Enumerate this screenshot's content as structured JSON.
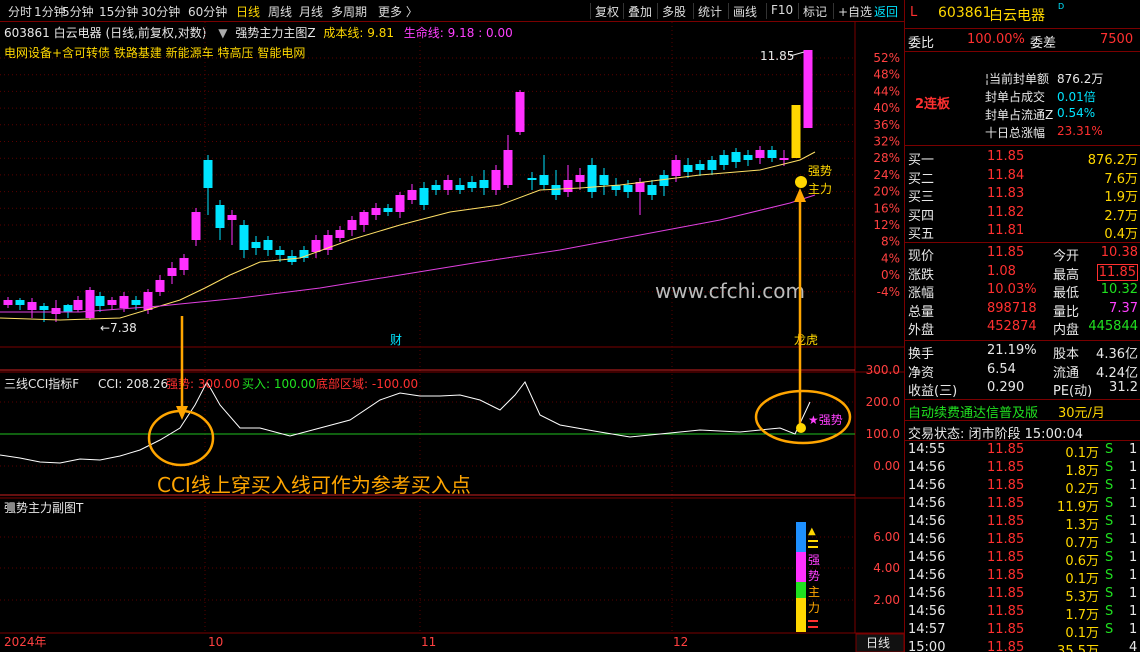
{
  "toolbar": {
    "left_tabs": [
      "分时",
      "1分钟",
      "5分钟",
      "15分钟",
      "30分钟",
      "60分钟",
      "日线",
      "周线",
      "月线",
      "多周期",
      "更多 〉"
    ],
    "active_tab": "日线",
    "right_tabs": [
      "复权",
      "叠加",
      "多股",
      "统计",
      "画线",
      "F10",
      "标记",
      "+自选"
    ],
    "return_label": "返回"
  },
  "main_chart": {
    "header_stock": "603861 白云电器 (日线,前复权,对数)",
    "indicator_name": "强势主力主图Z",
    "cost_label": "成本线: 9.81",
    "life_label": "生命线: 9.18 : 0.00",
    "concepts": "电网设备+含可转债 铁路基建 新能源车 特高压 智能电网",
    "high_marker": "11.85",
    "low_marker": "←7.38",
    "cai_marker": "财",
    "longhu_marker": "龙虎",
    "watermark": "www.cfchi.com",
    "signal_text": "强势",
    "signal_text2": "主力",
    "y_ticks": [
      "52%",
      "48%",
      "44%",
      "40%",
      "36%",
      "32%",
      "28%",
      "24%",
      "20%",
      "16%",
      "12%",
      "8%",
      "4%",
      "0%",
      "-4%"
    ]
  },
  "cci_panel": {
    "title": "三线CCI指标F",
    "cci_value": "CCI: 208.26",
    "strong_label": "强势: 300.00",
    "buy_label": "买入: 100.00",
    "bottom_label": "底部区域: -100.00",
    "y_ticks": [
      "300.0",
      "200.0",
      "100.0",
      "0.00"
    ],
    "annotation": "CCI线上穿买入线可作为参考买入点",
    "signal_text": "强势"
  },
  "sub_panel": {
    "title": "强势主力副图T",
    "y_ticks": [
      "6.00",
      "4.00",
      "2.00"
    ],
    "bar_labels": [
      "强",
      "势",
      "主",
      "力"
    ]
  },
  "x_axis": {
    "labels": [
      "2024年",
      "10",
      "11",
      "12"
    ],
    "period_button": "日线"
  },
  "quote": {
    "code": "603861",
    "name": "白云电器",
    "mark": "L",
    "wei_bi_label": "委比",
    "wei_bi": "100.00%",
    "wei_cha_label": "委差",
    "wei_cha": "7500",
    "limit_badge": "2连板",
    "seal_rows": [
      {
        "label": "当前封单额",
        "value": "876.2万"
      },
      {
        "label": "封单占成交",
        "value": "0.01倍"
      },
      {
        "label": "封单占流通Z",
        "value": "0.54%"
      },
      {
        "label": "十日总涨幅",
        "value": "23.31%"
      }
    ],
    "buy_book": [
      {
        "label": "买一",
        "price": "11.85",
        "vol": "876.2万"
      },
      {
        "label": "买二",
        "price": "11.84",
        "vol": "7.6万"
      },
      {
        "label": "买三",
        "price": "11.83",
        "vol": "1.9万"
      },
      {
        "label": "买四",
        "price": "11.82",
        "vol": "2.7万"
      },
      {
        "label": "买五",
        "price": "11.81",
        "vol": "0.4万"
      }
    ],
    "stats": [
      {
        "l1": "现价",
        "v1": "11.85",
        "l2": "今开",
        "v2": "10.38"
      },
      {
        "l1": "涨跌",
        "v1": "1.08",
        "l2": "最高",
        "v2": "11.85"
      },
      {
        "l1": "涨幅",
        "v1": "10.03%",
        "l2": "最低",
        "v2": "10.32"
      },
      {
        "l1": "总量",
        "v1": "898718",
        "l2": "量比",
        "v2": "7.37"
      },
      {
        "l1": "外盘",
        "v1": "452874",
        "l2": "内盘",
        "v2": "445844"
      }
    ],
    "stats2": [
      {
        "l1": "换手",
        "v1": "21.19%",
        "l2": "股本",
        "v2": "4.36亿"
      },
      {
        "l1": "净资",
        "v1": "6.54",
        "l2": "流通",
        "v2": "4.24亿"
      },
      {
        "l1": "收益(三)",
        "v1": "0.290",
        "l2": "PE(动)",
        "v2": "31.2"
      }
    ],
    "promo": "自动续费通达信普及版",
    "promo_price": "30元/月",
    "trade_status": "交易状态: 闭市阶段 15:00:04",
    "ticks": [
      {
        "t": "14:55",
        "p": "11.85",
        "v": "0.1万",
        "s": "S",
        "n": "1"
      },
      {
        "t": "14:56",
        "p": "11.85",
        "v": "1.8万",
        "s": "S",
        "n": "1"
      },
      {
        "t": "14:56",
        "p": "11.85",
        "v": "0.2万",
        "s": "S",
        "n": "1"
      },
      {
        "t": "14:56",
        "p": "11.85",
        "v": "11.9万",
        "s": "S",
        "n": "1"
      },
      {
        "t": "14:56",
        "p": "11.85",
        "v": "1.3万",
        "s": "S",
        "n": "1"
      },
      {
        "t": "14:56",
        "p": "11.85",
        "v": "0.7万",
        "s": "S",
        "n": "1"
      },
      {
        "t": "14:56",
        "p": "11.85",
        "v": "0.6万",
        "s": "S",
        "n": "1"
      },
      {
        "t": "14:56",
        "p": "11.85",
        "v": "0.1万",
        "s": "S",
        "n": "1"
      },
      {
        "t": "14:56",
        "p": "11.85",
        "v": "5.3万",
        "s": "S",
        "n": "1"
      },
      {
        "t": "14:56",
        "p": "11.85",
        "v": "1.7万",
        "s": "S",
        "n": "1"
      },
      {
        "t": "14:57",
        "p": "11.85",
        "v": "0.1万",
        "s": "S",
        "n": "1"
      },
      {
        "t": "15:00",
        "p": "11.85",
        "v": "35.5万",
        "s": "",
        "n": "4"
      }
    ]
  }
}
